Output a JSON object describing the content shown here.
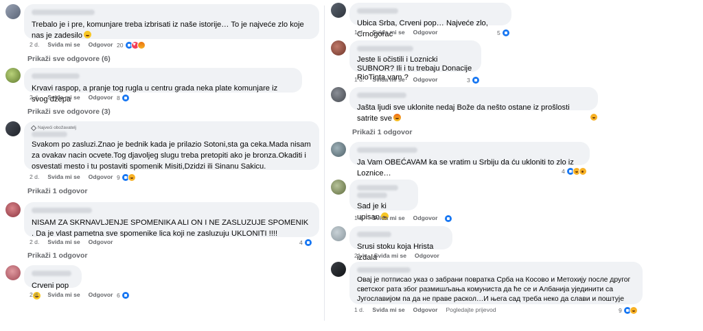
{
  "labels": {
    "like": "Sviđa mi se",
    "reply": "Odgovor",
    "translate": "Pogledajte prijevod"
  },
  "colors": {
    "bubble": "#f0f2f5",
    "meta": "#65676b",
    "like": "#1877f2",
    "love": "#f33e58"
  },
  "left": [
    {
      "text": "Trebalo je i pre, komunjare treba izbrisati iz naše istorije… To je najveće zlo koje nas je zadesilo",
      "emoji": "haha",
      "time": "2 d.",
      "reactions": [
        "like",
        "love",
        "angry"
      ],
      "count": "20",
      "more": "Prikaži sve odgovore (6)"
    },
    {
      "text": "Krvavi raspop, a pranje tog rugla u centru grada neka plate komunjare iz svog džepa",
      "time": "2 d.",
      "reactions": [
        "like"
      ],
      "count": "8",
      "more": "Prikaži sve odgovore (3)"
    },
    {
      "badge": "Najveći obožavatelj",
      "text": "Svakom po zasluzi.Znao je bednik kada je prilazio Sotoni,sta ga ceka.Mada nisam za ovakav nacin ocvete.Tog djavoljeg slugu treba pretopiti ako je bronza.Okaditi i osvestati mesto i tu postaviti spomenik Misiti,Dzidzi ili Sinanu Sakicu.",
      "time": "2 d.",
      "reactions": [
        "like",
        "haha"
      ],
      "count": "9",
      "more": "Prikaži 1 odgovor"
    },
    {
      "text": "NISAM ZA SKRNAVLJENJE SPOMENIKA ALI ON I NE ZASLUZUJE SPOMENIK . Da je vlast pametna sve spomenike lica koji ne zasluzuju UKLONITI !!!!",
      "time": "2 d.",
      "reactions": [
        "like"
      ],
      "count": "4",
      "more": "Prikaži 1 odgovor"
    },
    {
      "text": "Crveni pop",
      "emoji": "haha",
      "time": "2 d.",
      "reactions": [
        "like"
      ],
      "count": "6",
      "more": ""
    }
  ],
  "right": [
    {
      "text": "Ubica Srba, Crveni pop… Najveće zlo, Crnogorac",
      "time": "1 d.",
      "reactions": [
        "like"
      ],
      "count": "5"
    },
    {
      "text": "Jeste li očistili i Loznicki SUBNOR? Ili i tu trebaju Donacije RioTinta vam ?",
      "time": "1 d.",
      "reactions": [
        "like"
      ],
      "count": "3"
    },
    {
      "text": "Jašta ljudi sve uklonite nedaj Bože da nešto ostane iz prošlosti satrite sve",
      "emoji": "angry",
      "time": "",
      "reactions": [
        "haha"
      ],
      "count": "",
      "more": "Prikaži 1 odgovor"
    },
    {
      "text": "Ja Vam OBEĆAVAM ka se vratim u Srbiju da ću ukloniti to zlo iz Loznice…",
      "time": "",
      "reactions": [
        "like",
        "haha",
        "wow"
      ],
      "count": "4"
    },
    {
      "text": "Sad je ki upisan",
      "emoji": "haha",
      "time": "1 d.",
      "reactions": [
        "like"
      ],
      "count": ""
    },
    {
      "text": "Srusi stoku koja Hrista izdala",
      "time": "21 h",
      "reactions": [],
      "count": ""
    },
    {
      "text": "Овај је потписао указ о забрани повратка Срба на Косово и Метохију после другог светског рата због размишљања комуниста да ће се и Албанија ујединити са Југославијом па да не праве раскол…И њега сад треба неко да слави и поштује",
      "time": "1 d.",
      "reactions": [
        "like",
        "haha"
      ],
      "count": "9",
      "translate": true
    }
  ]
}
